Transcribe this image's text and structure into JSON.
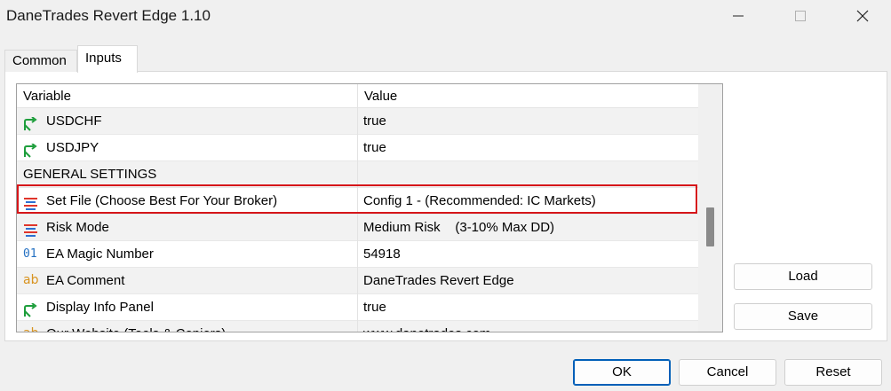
{
  "window": {
    "title": "DaneTrades Revert Edge 1.10",
    "controls": [
      "minimize-icon",
      "maximize-icon",
      "close-icon"
    ]
  },
  "tabs": [
    {
      "label": "Common",
      "selected": false
    },
    {
      "label": "Inputs",
      "selected": true
    }
  ],
  "grid": {
    "columns": {
      "variable": "Variable",
      "value": "Value"
    },
    "rows": [
      {
        "icon": "bool-arrow-icon",
        "name": "USDCHF",
        "value": "true"
      },
      {
        "icon": "bool-arrow-icon",
        "name": "USDJPY",
        "value": "true"
      },
      {
        "icon": "",
        "name": "GENERAL SETTINGS",
        "value": ""
      },
      {
        "icon": "enum-list-icon",
        "name": "Set File (Choose Best For Your Broker)",
        "value": "Config 1 - (Recommended: IC Markets)",
        "highlighted": true
      },
      {
        "icon": "enum-list-icon",
        "name": "Risk Mode",
        "value": "Medium Risk    (3-10% Max DD)"
      },
      {
        "icon": "integer-icon",
        "name": "EA Magic Number",
        "value": "54918"
      },
      {
        "icon": "string-icon",
        "name": "EA Comment",
        "value": "DaneTrades Revert Edge"
      },
      {
        "icon": "bool-arrow-icon",
        "name": "Display Info Panel",
        "value": "true"
      },
      {
        "icon": "string-icon",
        "name": "Our Website (Tools & Copiers)",
        "value": "www.danetrades.com"
      }
    ],
    "icon_labels": {
      "integer": "01",
      "string": "ab"
    }
  },
  "side_buttons": {
    "load": "Load",
    "save": "Save"
  },
  "footer_buttons": {
    "ok": "OK",
    "cancel": "Cancel",
    "reset": "Reset"
  },
  "colors": {
    "highlight_border": "#d6161a",
    "bool_icon": "#1e9e3c",
    "enum_icon_red": "#e0352b",
    "enum_icon_blue": "#2c6fd1",
    "integer_icon": "#2470c2",
    "string_icon": "#d8931f",
    "default_button_border": "#005fb8"
  }
}
